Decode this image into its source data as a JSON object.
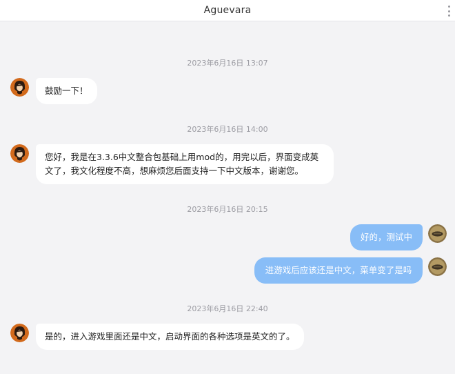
{
  "header": {
    "title": "Aguevara"
  },
  "icons": {
    "more": "more-vertical-icon",
    "contact_avatar": "che-portrait-avatar",
    "self_avatar": "user-avatar"
  },
  "colors": {
    "header_bg": "#ffffff",
    "chat_bg": "#f3f3f5",
    "incoming_bubble": "#ffffff",
    "outgoing_bubble": "#88bdf7"
  },
  "timestamps": [
    "2023年6月16日 13:07",
    "2023年6月16日 14:00",
    "2023年6月16日 20:15",
    "2023年6月16日 22:40"
  ],
  "messages": [
    {
      "direction": "incoming",
      "text": "鼓励一下！"
    },
    {
      "direction": "incoming",
      "lines": [
        "您好，我是在3.3.6中文整合包基础上用mod的，用完以后，界面变成英",
        "文了，我文化程度不高，想麻烦您后面支持一下中文版本，谢谢您。"
      ]
    },
    {
      "direction": "outgoing",
      "text": "好的，测试中"
    },
    {
      "direction": "outgoing",
      "text": "进游戏后应该还是中文，菜单变了是吗"
    },
    {
      "direction": "incoming",
      "text": "是的，进入游戏里面还是中文，启动界面的各种选项是英文的了。"
    }
  ]
}
